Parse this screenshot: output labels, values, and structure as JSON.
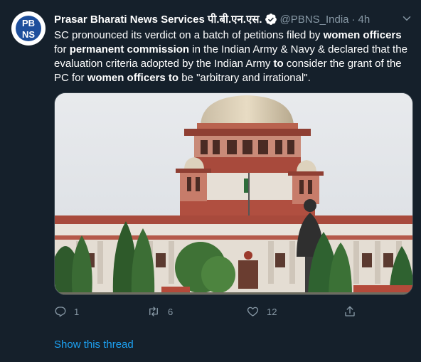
{
  "tweet": {
    "avatar": {
      "line1": "PB",
      "line2": "NS",
      "brand_color": "#1e4f9c"
    },
    "display_name": "Prasar Bharati News Services पी.बी.एन.एस.",
    "verified_icon": "verified-badge-icon",
    "handle": "@PBNS_India",
    "separator": "·",
    "time": "4h",
    "text": {
      "p1": "SC pronounced its verdict on a batch of petitions filed by ",
      "b1": "women officers",
      "p2": " for ",
      "b2": "permanent commission",
      "p3": " in the Indian Army & Navy & declared that the evaluation criteria adopted by the Indian Army ",
      "b3": "to",
      "p4": " consider the grant of the PC for ",
      "b4": "women officers to",
      "p5": " be \"arbitrary and irrational\"."
    },
    "media": {
      "description_icon": "supreme-court-building-photo"
    },
    "actions": {
      "reply_count": "1",
      "retweet_count": "6",
      "like_count": "12"
    },
    "show_thread": "Show this thread",
    "colors": {
      "background": "#15202b",
      "muted": "#8899a6",
      "link": "#1da1f2"
    }
  }
}
